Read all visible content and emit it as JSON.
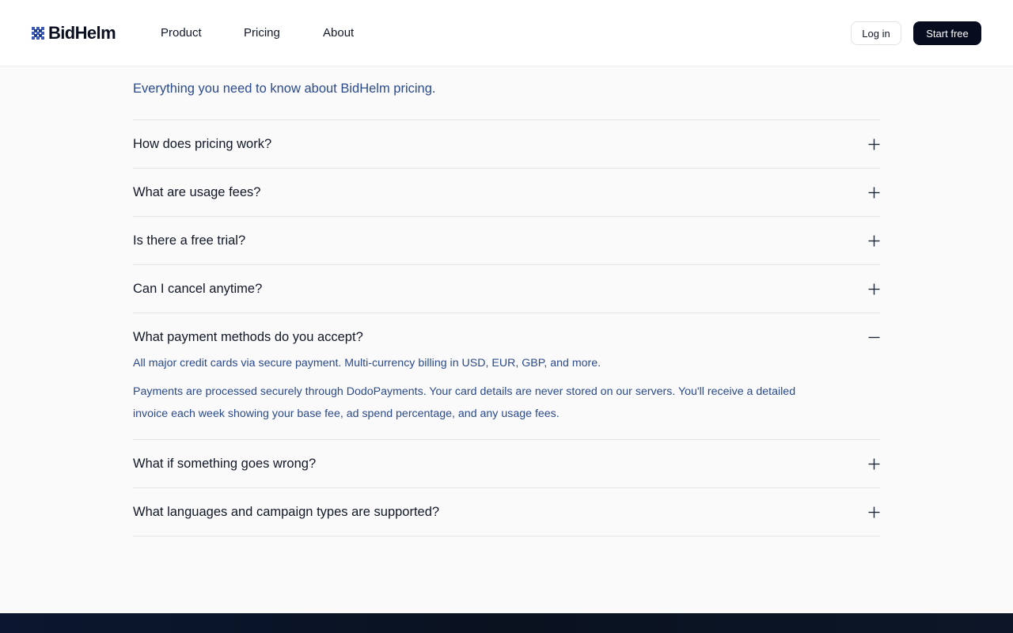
{
  "header": {
    "logo_text": "BidHelm",
    "nav": [
      "Product",
      "Pricing",
      "About"
    ],
    "login_label": "Log in",
    "cta_label": "Start free"
  },
  "faq": {
    "subtitle": "Everything you need to know about BidHelm pricing.",
    "items": [
      {
        "question": "How does pricing work?",
        "expanded": false,
        "icon": "plus-icon"
      },
      {
        "question": "What are usage fees?",
        "expanded": false,
        "icon": "plus-icon"
      },
      {
        "question": "Is there a free trial?",
        "expanded": false,
        "icon": "plus-icon"
      },
      {
        "question": "Can I cancel anytime?",
        "expanded": false,
        "icon": "plus-icon"
      },
      {
        "question": "What payment methods do you accept?",
        "expanded": true,
        "icon": "minus-icon",
        "answer": [
          "All major credit cards via secure payment. Multi-currency billing in USD, EUR, GBP, and more.",
          "Payments are processed securely through DodoPayments. Your card details are never stored on our servers. You'll receive a detailed invoice each week showing your base fee, ad spend percentage, and any usage fees."
        ]
      },
      {
        "question": "What if something goes wrong?",
        "expanded": false,
        "icon": "plus-icon"
      },
      {
        "question": "What languages and campaign types are supported?",
        "expanded": false,
        "icon": "plus-icon"
      }
    ]
  },
  "colors": {
    "accent_text": "#2a4a8c",
    "cta_background": "#070d1f",
    "logo_mark": "#3b5bb5",
    "footer": "#0b1326"
  }
}
